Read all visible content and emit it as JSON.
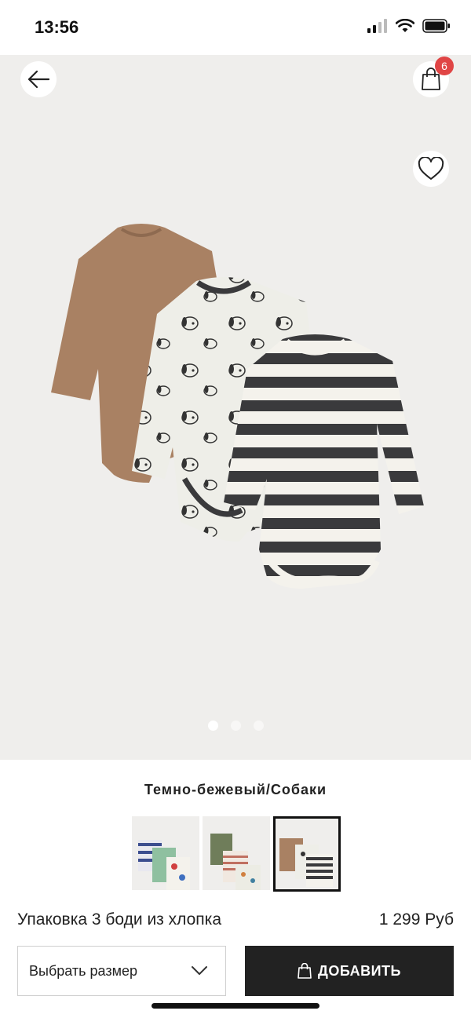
{
  "status": {
    "time": "13:56"
  },
  "header": {
    "bag_count": "6"
  },
  "hero": {
    "slides": 3,
    "active_slide": 1
  },
  "product": {
    "color_name": "Темно-бежевый/Собаки",
    "title": "Упаковка 3 боди из хлопка",
    "price": "1 299 Руб",
    "swatches": [
      "stripes-green-cars",
      "green-stripes-pattern",
      "beige-dogs-stripes"
    ],
    "selected_swatch": 2
  },
  "actions": {
    "size_label": "Выбрать размер",
    "add_label": "ДОБАВИТЬ"
  },
  "colors": {
    "badge": "#e04545",
    "hero_bg": "#efeeec",
    "button_bg": "#222222"
  }
}
